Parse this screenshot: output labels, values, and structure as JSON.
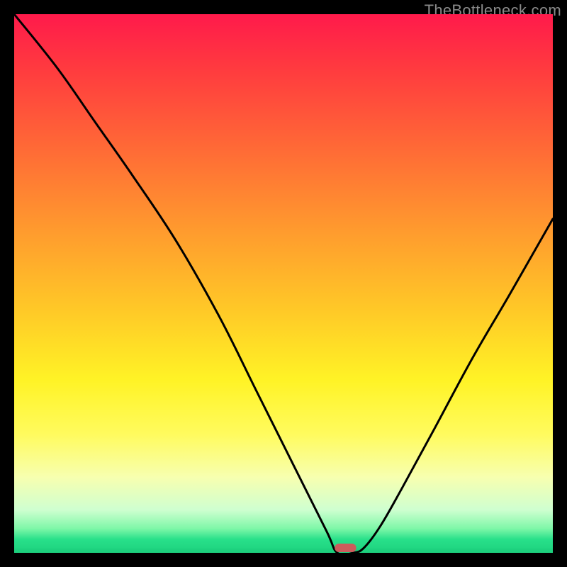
{
  "watermark": "TheBottleneck.com",
  "chart_data": {
    "type": "line",
    "title": "",
    "xlabel": "",
    "ylabel": "",
    "xlim": [
      0,
      100
    ],
    "ylim": [
      0,
      100
    ],
    "grid": false,
    "series": [
      {
        "name": "bottleneck-curve",
        "x": [
          0,
          8,
          15,
          22,
          30,
          38,
          45,
          52,
          58,
          60,
          63,
          65,
          68,
          72,
          78,
          85,
          92,
          100
        ],
        "values": [
          100,
          90,
          80,
          70,
          58,
          44,
          30,
          16,
          4,
          0,
          0,
          1,
          5,
          12,
          23,
          36,
          48,
          62
        ]
      }
    ],
    "marker": {
      "name": "optimal-point",
      "x": 61.5,
      "y": 0,
      "width_x": 4,
      "color": "#cc5c5c"
    },
    "gradient_stops": [
      {
        "offset": 0.0,
        "color": "#ff1a4b"
      },
      {
        "offset": 0.1,
        "color": "#ff3a3f"
      },
      {
        "offset": 0.25,
        "color": "#ff6a36"
      },
      {
        "offset": 0.4,
        "color": "#ff9a2e"
      },
      {
        "offset": 0.55,
        "color": "#ffc927"
      },
      {
        "offset": 0.68,
        "color": "#fff326"
      },
      {
        "offset": 0.78,
        "color": "#fffb5e"
      },
      {
        "offset": 0.86,
        "color": "#f7ffb0"
      },
      {
        "offset": 0.92,
        "color": "#cfffd0"
      },
      {
        "offset": 0.955,
        "color": "#7ef7a8"
      },
      {
        "offset": 0.975,
        "color": "#28e08a"
      },
      {
        "offset": 1.0,
        "color": "#1dd17e"
      }
    ]
  }
}
